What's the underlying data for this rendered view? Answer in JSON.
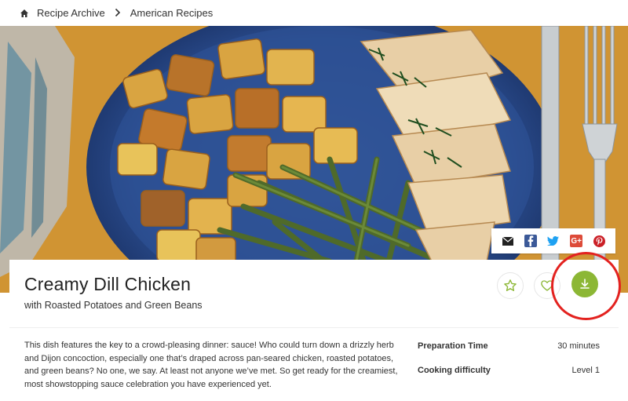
{
  "breadcrumb": {
    "items": [
      {
        "label": "Recipe Archive"
      },
      {
        "label": "American Recipes"
      }
    ]
  },
  "recipe": {
    "title": "Creamy Dill Chicken",
    "subtitle": "with Roasted Potatoes and Green Beans",
    "description": "This dish features the key to a crowd-pleasing dinner: sauce! Who could turn down a drizzly herb and Dijon concoction, especially one that’s draped across pan-seared chicken, roasted potatoes, and green beans? No one, we say. At least not anyone we’ve met. So get ready for the creamiest, most showstopping sauce celebration you have experienced yet."
  },
  "meta": [
    {
      "key": "Preparation Time",
      "value": "30 minutes"
    },
    {
      "key": "Cooking difficulty",
      "value": "Level 1"
    }
  ],
  "share": {
    "icons": [
      "email-icon",
      "facebook-icon",
      "twitter-icon",
      "google-plus-icon",
      "pinterest-icon"
    ],
    "gplus_text": "G+"
  },
  "colors": {
    "accent_green": "#8cb735",
    "highlight_ring": "#e3221f",
    "facebook": "#3b5998",
    "twitter": "#1da1f2",
    "google_plus": "#dd4b39",
    "pinterest": "#cb2027"
  }
}
